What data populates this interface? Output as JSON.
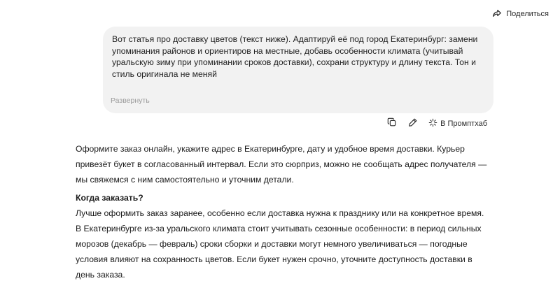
{
  "header": {
    "share_label": "Поделиться"
  },
  "user_message": {
    "text": "Вот статья про доставку цветов (текст ниже). Адаптируй её под город Екатеринбург: замени упоминания районов и ориентиров на местные, добавь особенности климата (учитывай уральскую зиму при упоминании сроков доставки), сохрани структуру и длину текста. Тон и стиль оригинала не меняй",
    "expand_label": "Развернуть"
  },
  "message_actions": {
    "copy_icon": "copy-icon",
    "edit_icon": "pencil-icon",
    "promptbub_icon": "sparkle-icon",
    "promptbub_label": "В Промптхаб"
  },
  "answer": {
    "paragraph1": "Оформите заказ онлайн, укажите адрес в Екатеринбурге, дату и удобное время доставки. Курьер привезёт букет в согласованный интервал. Если это сюрприз, можно не сообщать адрес получателя — мы свяжемся с ним самостоятельно и уточним детали.",
    "heading": "Когда заказать?",
    "paragraph2": "Лучше оформить заказ заранее, особенно если доставка нужна к празднику или на конкретное время. В Екатеринбурге из-за уральского климата стоит учитывать сезонные особенности: в период сильных морозов (декабрь — февраль) сроки сборки и доставки могут немного увеличиваться — погодные условия влияют на сохранность цветов. Если букет нужен срочно, уточните доступность доставки в день заказа."
  }
}
